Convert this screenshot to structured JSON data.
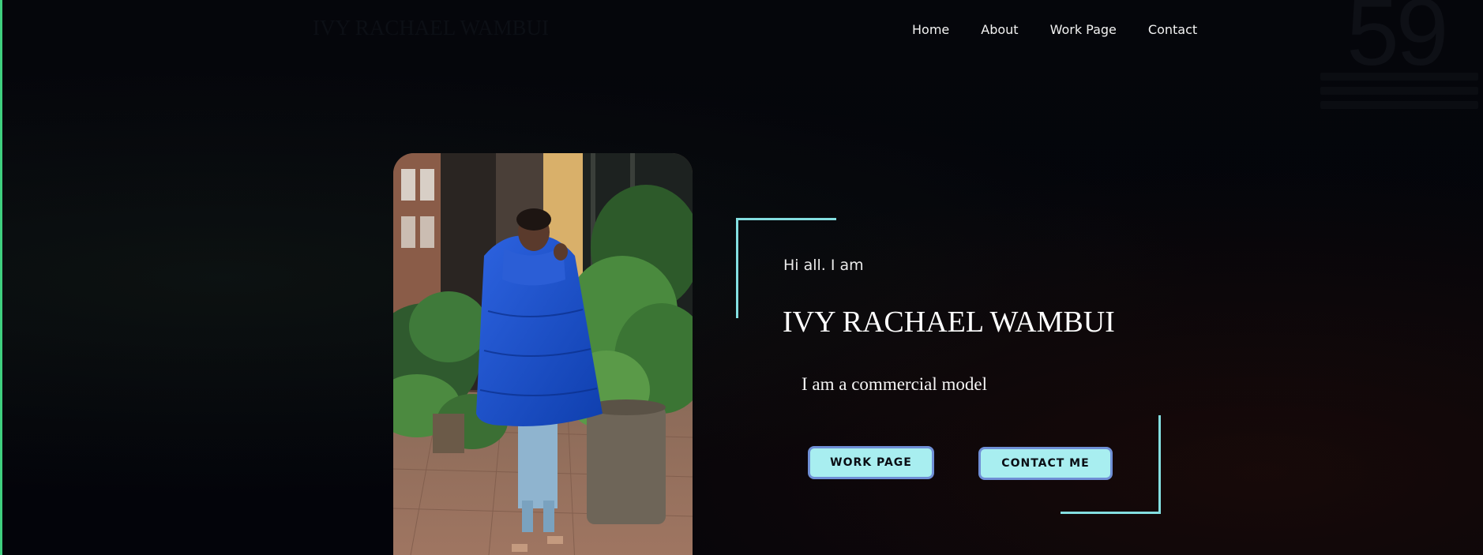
{
  "brand": {
    "name": "IVY RACHAEL WAMBUI"
  },
  "nav": {
    "items": [
      {
        "label": "Home"
      },
      {
        "label": "About"
      },
      {
        "label": "Work Page"
      },
      {
        "label": "Contact"
      }
    ]
  },
  "background": {
    "number": "59"
  },
  "hero": {
    "greeting": "Hi all. I am",
    "name": "IVY RACHAEL WAMBUI",
    "subtitle": "I am a commercial model",
    "buttons": {
      "work_label": "WORK PAGE",
      "contact_label": "CONTACT ME"
    },
    "photo": {
      "subject": "model in blue puffer coat among plants"
    }
  },
  "colors": {
    "accent_cyan": "#83dee0",
    "button_fill": "#a8eef0",
    "button_border": "#6f8fd6",
    "left_bar": "#3fcf7f",
    "background": "#03040a"
  }
}
